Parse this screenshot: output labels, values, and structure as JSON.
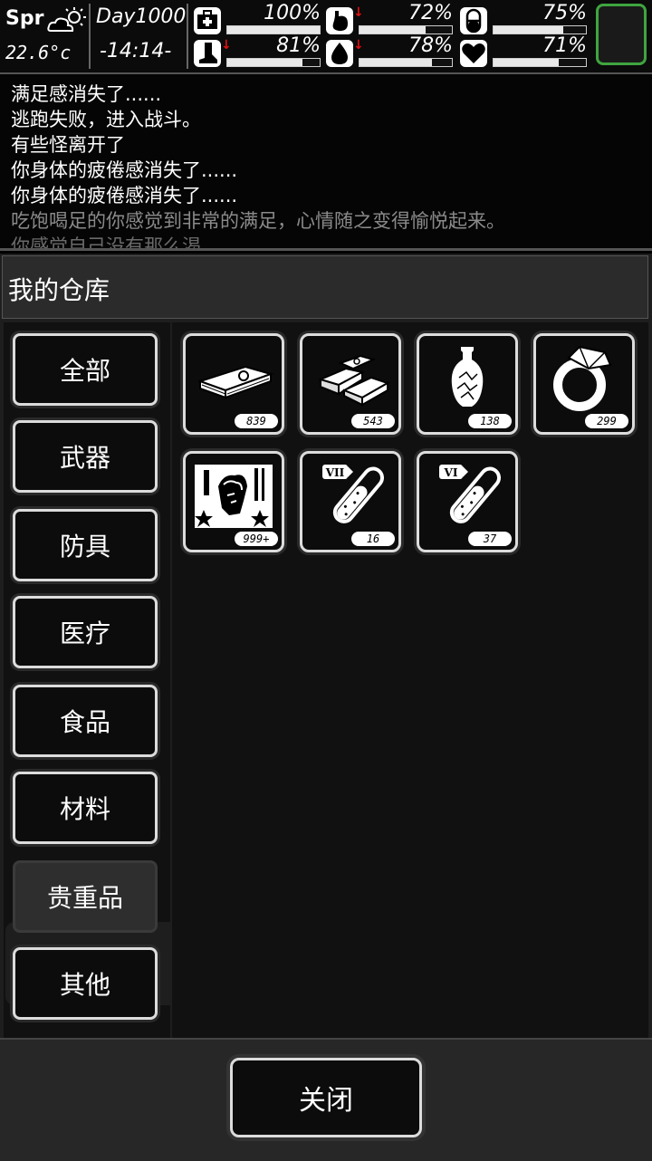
{
  "status": {
    "season": "Spr",
    "weather_icon": "partly-cloudy-sun-icon",
    "temperature": "22.6°c",
    "day": "Day1000",
    "time": "-14:14-",
    "stats": [
      {
        "name": "health",
        "icon": "medkit-icon",
        "value": "100%",
        "level": 1.0,
        "trend_down": false
      },
      {
        "name": "hunger",
        "icon": "stomach-icon",
        "value": "72%",
        "level": 0.72,
        "trend_down": true
      },
      {
        "name": "medicine",
        "icon": "pill-icon",
        "value": "75%",
        "level": 0.75,
        "trend_down": false
      },
      {
        "name": "stamina",
        "icon": "leg-icon",
        "value": "81%",
        "level": 0.81,
        "trend_down": true
      },
      {
        "name": "thirst",
        "icon": "water-drop-icon",
        "value": "78%",
        "level": 0.78,
        "trend_down": true
      },
      {
        "name": "mood",
        "icon": "heart-icon",
        "value": "71%",
        "level": 0.71,
        "trend_down": false
      }
    ]
  },
  "log": [
    "满足感消失了......",
    "逃跑失败，进入战斗。",
    "有些怪离开了",
    "你身体的疲倦感消失了......",
    "你身体的疲倦感消失了......",
    "吃饱喝足的你感觉到非常的满足，心情随之变得愉悦起来。",
    "你感觉自己没有那么渴"
  ],
  "warehouse": {
    "title": "我的仓库",
    "categories": [
      "全部",
      "武器",
      "防具",
      "医疗",
      "食品",
      "材料",
      "贵重品",
      "其他"
    ],
    "active_category": "贵重品",
    "items": [
      {
        "icon": "cash-stack-icon",
        "count": "839"
      },
      {
        "icon": "gold-bars-icon",
        "count": "543"
      },
      {
        "icon": "vase-icon",
        "count": "138"
      },
      {
        "icon": "diamond-ring-icon",
        "count": "299"
      },
      {
        "icon": "zombie-card-icon",
        "count": "999+"
      },
      {
        "icon": "test-tube-vii-icon",
        "count": "16",
        "label": "VII"
      },
      {
        "icon": "test-tube-vi-icon",
        "count": "37",
        "label": "VI"
      }
    ],
    "close_label": "关闭"
  },
  "colors": {
    "accent_green": "#3fa53f",
    "trend_red": "#e01010"
  }
}
